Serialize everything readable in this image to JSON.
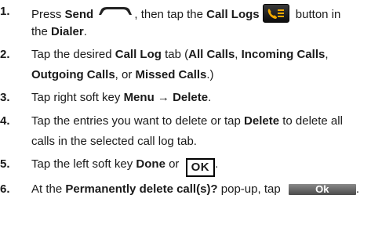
{
  "steps": [
    {
      "num": "1.",
      "a": "Press ",
      "send": "Send",
      "b": ", then tap the ",
      "calllogs": "Call Logs",
      "c": " button in",
      "line2a": "the ",
      "dialer": "Dialer",
      "line2b": "."
    },
    {
      "num": "2.",
      "a": "Tap the desired ",
      "calllog": "Call Log",
      "b": " tab (",
      "allcalls": "All Calls",
      "c": ", ",
      "incoming": "Incoming Calls",
      "d": ",",
      "outgoing": "Outgoing Calls",
      "e": ", or ",
      "missed": "Missed Calls",
      "f": ".)"
    },
    {
      "num": "3.",
      "a": "Tap right soft key ",
      "menu": "Menu",
      "arrow": " → ",
      "delete": "Delete",
      "b": "."
    },
    {
      "num": "4.",
      "a": "Tap the entries you want to delete or tap ",
      "delete": "Delete",
      "b": " to delete all",
      "line2": "calls in the selected call log tab."
    },
    {
      "num": "5.",
      "a": "Tap the left soft key ",
      "done": "Done",
      "b": " or ",
      "ok": "OK",
      "c": "."
    },
    {
      "num": "6.",
      "a": "At the ",
      "popup": "Permanently delete call(s)?",
      "b": " pop-up, tap ",
      "ok": "Ok",
      "c": "."
    }
  ],
  "icons": {
    "send": "send-key-icon",
    "calllogs": "call-logs-icon"
  },
  "colors": {
    "calllogs_phone": "#f2a900",
    "ok_button": "#6a6a6a"
  }
}
